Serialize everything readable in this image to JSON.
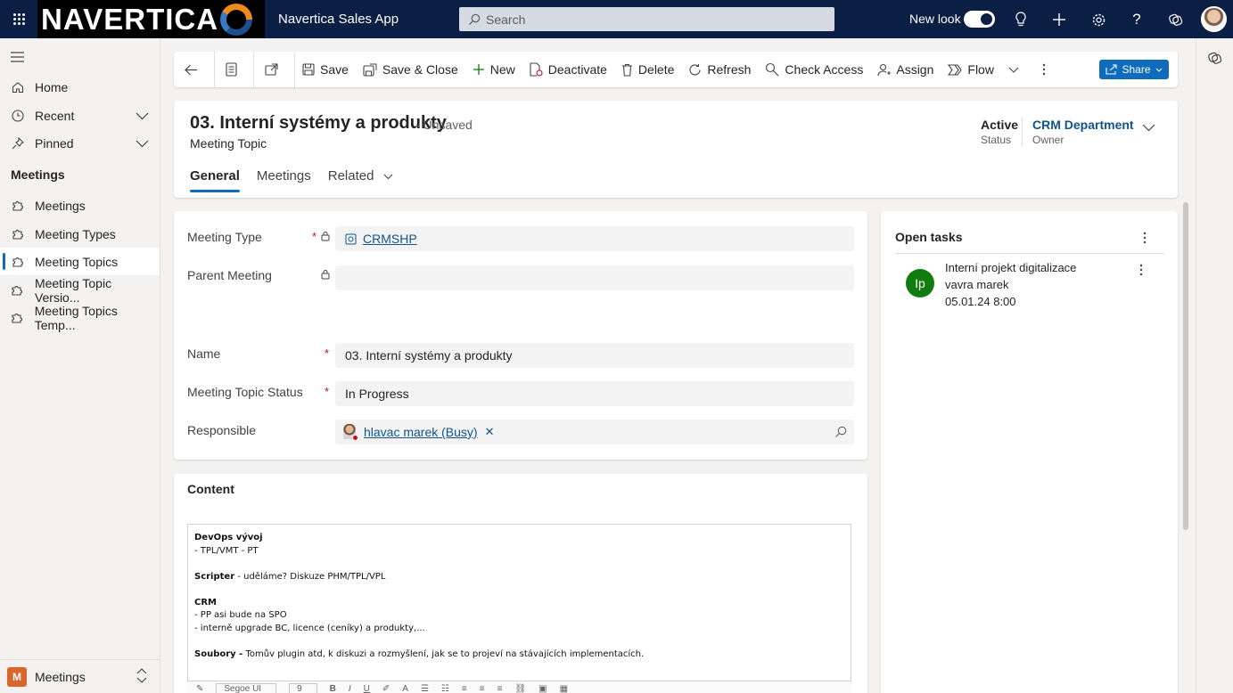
{
  "topbar": {
    "brand": "NAVERTICA",
    "app_name": "Navertica Sales App",
    "search_placeholder": "Search",
    "new_look_label": "New look",
    "new_look_enabled": true
  },
  "nav": {
    "items": [
      {
        "label": "Home"
      },
      {
        "label": "Recent"
      },
      {
        "label": "Pinned"
      }
    ],
    "section_title": "Meetings",
    "section_items": [
      {
        "label": "Meetings"
      },
      {
        "label": "Meeting Types"
      },
      {
        "label": "Meeting Topics"
      },
      {
        "label": "Meeting Topic Versio..."
      },
      {
        "label": "Meeting Topics Temp..."
      }
    ],
    "area": {
      "badge": "M",
      "label": "Meetings"
    }
  },
  "commands": {
    "save": "Save",
    "save_close": "Save & Close",
    "new": "New",
    "deactivate": "Deactivate",
    "delete": "Delete",
    "refresh": "Refresh",
    "check_access": "Check Access",
    "assign": "Assign",
    "flow": "Flow",
    "share": "Share"
  },
  "record": {
    "title": "03. Interní systémy a produkty",
    "unsaved": "- Unsaved",
    "entity": "Meeting Topic",
    "status_value": "Active",
    "status_label": "Status",
    "owner_value": "CRM Department",
    "owner_label": "Owner"
  },
  "tabs": [
    {
      "label": "General"
    },
    {
      "label": "Meetings"
    },
    {
      "label": "Related"
    }
  ],
  "form": {
    "meeting_type_label": "Meeting Type",
    "meeting_type_value": "CRMSHP",
    "parent_meeting_label": "Parent Meeting",
    "parent_meeting_value": "",
    "name_label": "Name",
    "name_value": "03. Interní systémy a produkty",
    "status_label": "Meeting Topic Status",
    "status_value": "In Progress",
    "responsible_label": "Responsible",
    "responsible_value": "hlavac marek (Busy)"
  },
  "content": {
    "title": "Content",
    "lines": [
      {
        "bold": "DevOps vývoj",
        "text": ""
      },
      {
        "bold": "",
        "text": "- TPL/VMT - PT"
      },
      {
        "bold": "",
        "text": ""
      },
      {
        "bold": "Scripter",
        "text": " - uděláme? Diskuze PHM/TPL/VPL"
      },
      {
        "bold": "",
        "text": ""
      },
      {
        "bold": "CRM",
        "text": ""
      },
      {
        "bold": "",
        "text": "- PP asi bude na SPO"
      },
      {
        "bold": "",
        "text": "- interně upgrade BC, licence (ceníky) a produkty,..."
      },
      {
        "bold": "",
        "text": ""
      },
      {
        "bold": "Soubory -",
        "text": " Tomův plugin atd, k diskuzi a rozmyšlení, jak se to projeví na stávajících implementacích."
      }
    ],
    "toolbar_font": "Segoe UI",
    "toolbar_size": "9"
  },
  "tasks": {
    "title": "Open tasks",
    "items": [
      {
        "initials": "Ip",
        "title": "Interní projekt digitalizace",
        "owner": "vavra marek",
        "date": "05.01.24 8:00"
      }
    ]
  },
  "colors": {
    "topbar": "#0b1f44",
    "accent": "#0f6cbd",
    "task_avatar": "#107c10",
    "area_badge": "#d9652b",
    "required": "#c50f1f"
  }
}
